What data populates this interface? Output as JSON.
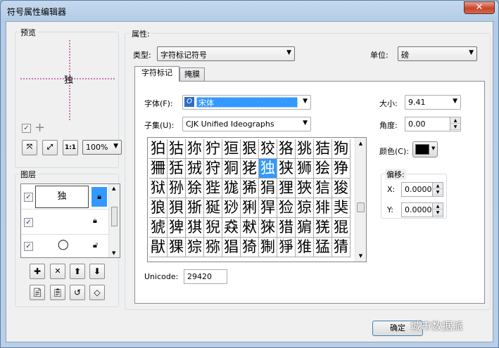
{
  "window": {
    "title": "符号属性编辑器",
    "close_glyph": "✕"
  },
  "preview": {
    "label": "预览",
    "preview_char": "独",
    "zoom_value": "100%",
    "zoom_buttons": [
      "⤧",
      "⤢",
      "1:1"
    ]
  },
  "layers": {
    "label": "图层",
    "rows": [
      {
        "checked": true,
        "symbol": "独",
        "locked": true,
        "selected": true
      },
      {
        "checked": true,
        "symbol": "",
        "locked": true,
        "selected": false
      },
      {
        "checked": true,
        "symbol": "◯",
        "locked": false,
        "selected": false
      }
    ],
    "tool_buttons": [
      "✚",
      "✕",
      "⬆",
      "⬇"
    ]
  },
  "properties": {
    "label": "属性:",
    "type_label": "类型:",
    "type_value": "字符标记符号",
    "unit_label": "单位:",
    "unit_value": "磅"
  },
  "tabs": [
    "字符标记",
    "掩膜"
  ],
  "char_tab": {
    "font_label": "字体(F):",
    "font_value": "宋体",
    "subset_label": "子集(U):",
    "subset_value": "CJK Unified Ideographs",
    "size_label": "大小:",
    "size_value": "9.41",
    "angle_label": "角度:",
    "angle_value": "0.00",
    "color_label": "颜色(C):",
    "color_hex": "#000000",
    "offset_label": "偏移:",
    "x_label": "X:",
    "x_value": "0.0000",
    "y_label": "Y:",
    "y_value": "0.0000",
    "unicode_label": "Unicode:",
    "unicode_value": "29420",
    "selected_index": 17,
    "glyphs": [
      "狛",
      "狜",
      "狝",
      "狞",
      "狟",
      "狠",
      "狡",
      "狢",
      "狣",
      "狤",
      "狥",
      "狦",
      "狧",
      "狨",
      "狩",
      "狪",
      "狫",
      "独",
      "狭",
      "狮",
      "狯",
      "狰",
      "狱",
      "狲",
      "狳",
      "狴",
      "狵",
      "狶",
      "狷",
      "狸",
      "狹",
      "狺",
      "狻",
      "狼",
      "狽",
      "狾",
      "狿",
      "猀",
      "猁",
      "猂",
      "猃",
      "猄",
      "猅",
      "猆",
      "猇",
      "猈",
      "猉",
      "猊",
      "猋",
      "猌",
      "猍",
      "猎",
      "猏",
      "猐",
      "猑",
      "猒",
      "猓",
      "猔",
      "猕",
      "猖",
      "猗",
      "猘",
      "猙",
      "猚",
      "猛",
      "猜"
    ]
  },
  "footer": {
    "ok_label": "确定"
  },
  "watermark": "城市数据派"
}
